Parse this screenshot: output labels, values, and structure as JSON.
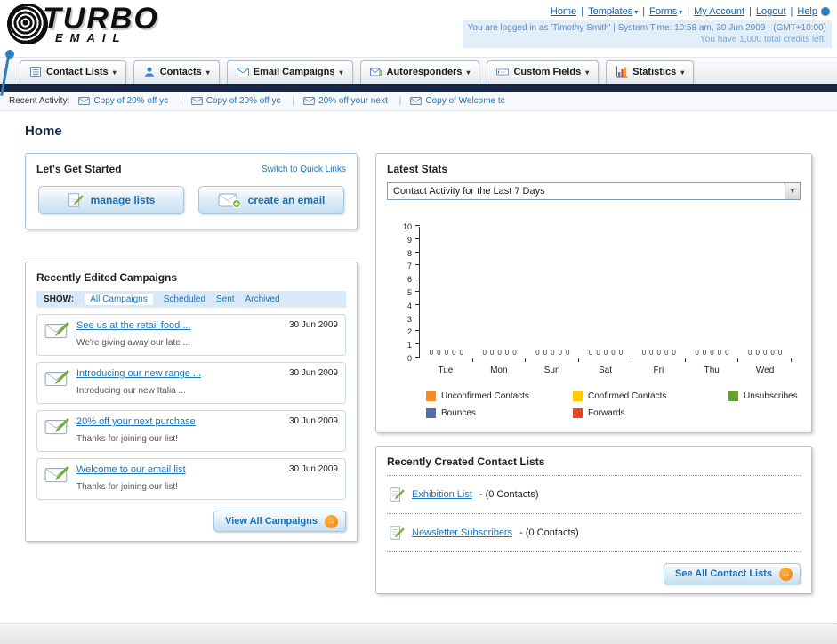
{
  "header": {
    "logo_text": "TURBO",
    "logo_sub": "EMAIL",
    "nav": {
      "home": "Home",
      "templates": "Templates",
      "forms": "Forms",
      "my_account": "My Account",
      "logout": "Logout",
      "help": "Help"
    },
    "login_info": "You are logged in as 'Timothy Smith' | System Time: 10:58 am, 30 Jun 2009 - (GMT+10:00)",
    "credits_info": "You have 1,000 total credits left."
  },
  "nav_tabs": [
    {
      "label": "Contact Lists"
    },
    {
      "label": "Contacts"
    },
    {
      "label": "Email Campaigns"
    },
    {
      "label": "Autoresponders"
    },
    {
      "label": "Custom Fields"
    },
    {
      "label": "Statistics"
    }
  ],
  "recent_activity": {
    "label": "Recent Activity:",
    "items": [
      {
        "label": "Copy of 20% off yc"
      },
      {
        "label": "Copy of 20% off yc"
      },
      {
        "label": "20% off your next"
      },
      {
        "label": "Copy of Welcome tc"
      }
    ]
  },
  "page": {
    "title": "Home"
  },
  "get_started": {
    "title": "Let's Get Started",
    "switch_link": "Switch to Quick Links",
    "manage_lists": "manage lists",
    "create_email": "create an email"
  },
  "campaigns": {
    "title": "Recently Edited Campaigns",
    "show_label": "SHOW:",
    "filters": [
      {
        "label": "All Campaigns"
      },
      {
        "label": "Scheduled"
      },
      {
        "label": "Sent"
      },
      {
        "label": "Archived"
      }
    ],
    "items": [
      {
        "title": "See us at the retail food ...",
        "subtitle": "We're giving away our late ...",
        "date": "30 Jun 2009"
      },
      {
        "title": "Introducing our new range ...",
        "subtitle": "Introducing our new Italia ...",
        "date": "30 Jun 2009"
      },
      {
        "title": "20% off your next purchase",
        "subtitle": "Thanks for joining our list!",
        "date": "30 Jun 2009"
      },
      {
        "title": "Welcome to our email list",
        "subtitle": "Thanks for joining our list!",
        "date": "30 Jun 2009"
      }
    ],
    "view_all_label": "View All Campaigns"
  },
  "stats": {
    "title": "Latest Stats",
    "period_value": "Contact Activity for the Last 7 Days"
  },
  "chart_data": {
    "type": "bar",
    "title": "Contact Activity for the Last 7 Days",
    "categories": [
      "Tue",
      "Mon",
      "Sun",
      "Sat",
      "Fri",
      "Thu",
      "Wed"
    ],
    "series": [
      {
        "name": "Unconfirmed Contacts",
        "color": "#F68B1F",
        "values": [
          0,
          0,
          0,
          0,
          0,
          0,
          0
        ]
      },
      {
        "name": "Confirmed Contacts",
        "color": "#FFCC00",
        "values": [
          0,
          0,
          0,
          0,
          0,
          0,
          0
        ]
      },
      {
        "name": "Unsubscribes",
        "color": "#64A12D",
        "values": [
          0,
          0,
          0,
          0,
          0,
          0,
          0
        ]
      },
      {
        "name": "Bounces",
        "color": "#4F6FA6",
        "values": [
          0,
          0,
          0,
          0,
          0,
          0,
          0
        ]
      },
      {
        "name": "Forwards",
        "color": "#E2482A",
        "values": [
          0,
          0,
          0,
          0,
          0,
          0,
          0
        ]
      }
    ],
    "ylim": [
      0,
      10
    ],
    "yticks": [
      0,
      1,
      2,
      3,
      4,
      5,
      6,
      7,
      8,
      9,
      10
    ],
    "grid": false,
    "legend_position": "bottom"
  },
  "contact_lists": {
    "title": "Recently Created Contact Lists",
    "items": [
      {
        "name": "Exhibition List",
        "detail": "- (0 Contacts)"
      },
      {
        "name": "Newsletter Subscribers",
        "detail": "- (0 Contacts)"
      }
    ],
    "see_all_label": "See All Contact Lists"
  }
}
